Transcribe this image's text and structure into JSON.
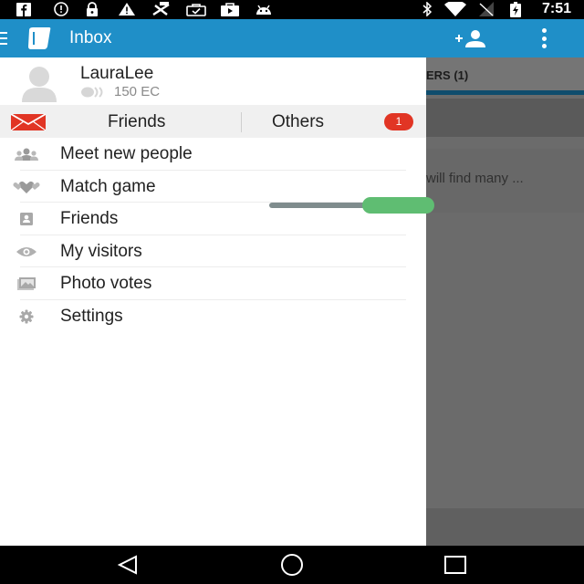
{
  "status_bar": {
    "time": "7:51",
    "left_icons": [
      "facebook-icon",
      "alert-circle-icon",
      "lock-icon",
      "warning-icon",
      "fail-icon",
      "briefcase-check-icon",
      "play-store-bag-icon",
      "android-icon"
    ],
    "right_icons": [
      "bluetooth-icon",
      "wifi-icon",
      "signal-icon",
      "battery-icon"
    ]
  },
  "app_bar": {
    "title": "Inbox",
    "color": "#1f8fc8",
    "icons": [
      "menu-icon",
      "app-logo-icon",
      "add-person-icon",
      "overflow-menu-icon"
    ]
  },
  "profile": {
    "username": "LauraLee",
    "credits": "150 EC"
  },
  "message_tabs": {
    "friends_label": "Friends",
    "others_label": "Others",
    "others_badge": "1",
    "badge_color": "#e13524"
  },
  "menu": {
    "items": [
      {
        "label": "Meet new people",
        "icon": "people-icon"
      },
      {
        "label": "Match game",
        "icon": "hearts-icon"
      },
      {
        "label": "Friends",
        "icon": "contact-card-icon"
      },
      {
        "label": "My visitors",
        "icon": "eye-icon"
      },
      {
        "label": "Photo votes",
        "icon": "photos-icon"
      },
      {
        "label": "Settings",
        "icon": "gear-icon"
      }
    ]
  },
  "background": {
    "tab_label": "ERS (1)",
    "preview_text": "will find many ..."
  },
  "slider": {
    "track_color": "#7f8c8d",
    "thumb_color": "#5fbd72"
  },
  "nav_bar": {
    "buttons": [
      "back-icon",
      "home-icon",
      "recents-icon"
    ]
  }
}
